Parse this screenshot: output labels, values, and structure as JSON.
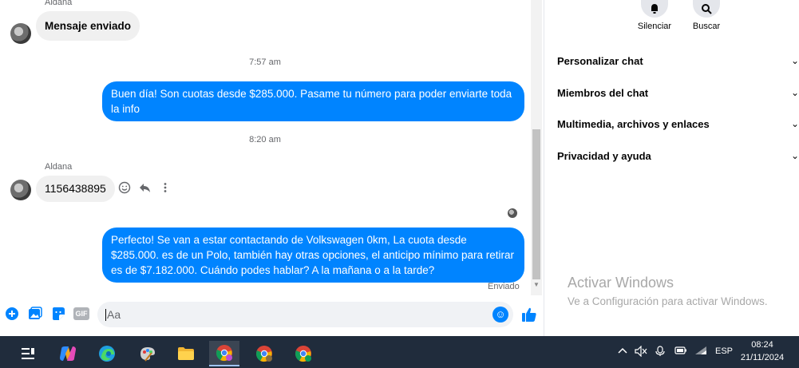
{
  "chat": {
    "messages": [
      {
        "sender": "Aldana",
        "text": "Mensaje enviado"
      },
      {
        "time": "7:57 am"
      },
      {
        "outgoing": "Buen día! Son cuotas desde $285.000. Pasame tu número para poder enviarte toda la info"
      },
      {
        "time": "8:20 am"
      },
      {
        "sender": "Aldana",
        "text": "1156438895"
      },
      {
        "outgoing": "Perfecto!  Se van a estar contactando de Volkswagen 0km, La cuota desde $285.000. es de un Polo, también hay otras opciones, el anticipo mínimo para retirar es de $7.182.000. Cuándo podes hablar? A la mañana o a la tarde?"
      }
    ],
    "sender_top": "Aldana",
    "bubble1": "Mensaje enviado",
    "time1": "7:57 am",
    "out1": "Buen día! Son cuotas desde $285.000. Pasame tu número para poder enviarte toda la info",
    "time2": "8:20 am",
    "sender2": "Aldana",
    "bubble2": "1156438895",
    "out2": "Perfecto!  Se van a estar contactando de Volkswagen 0km, La cuota desde $285.000. es de un Polo, también hay otras opciones, el anticipo mínimo para retirar es de $7.182.000. Cuándo podes hablar? A la mañana o a la tarde?",
    "status": "Enviado"
  },
  "composer": {
    "placeholder": "Aa",
    "gif_label": "GIF"
  },
  "side": {
    "mute_label": "Silenciar",
    "search_label": "Buscar",
    "menu": [
      {
        "label": "Personalizar chat"
      },
      {
        "label": "Miembros del chat"
      },
      {
        "label": "Multimedia, archivos y enlaces"
      },
      {
        "label": "Privacidad y ayuda"
      }
    ]
  },
  "watermark": {
    "title": "Activar Windows",
    "subtitle": "Ve a Configuración para activar Windows."
  },
  "taskbar": {
    "language": "ESP",
    "time": "08:24",
    "date": "21/11/2024"
  },
  "colors": {
    "accent": "#0084ff",
    "taskbar": "#202c3c"
  }
}
